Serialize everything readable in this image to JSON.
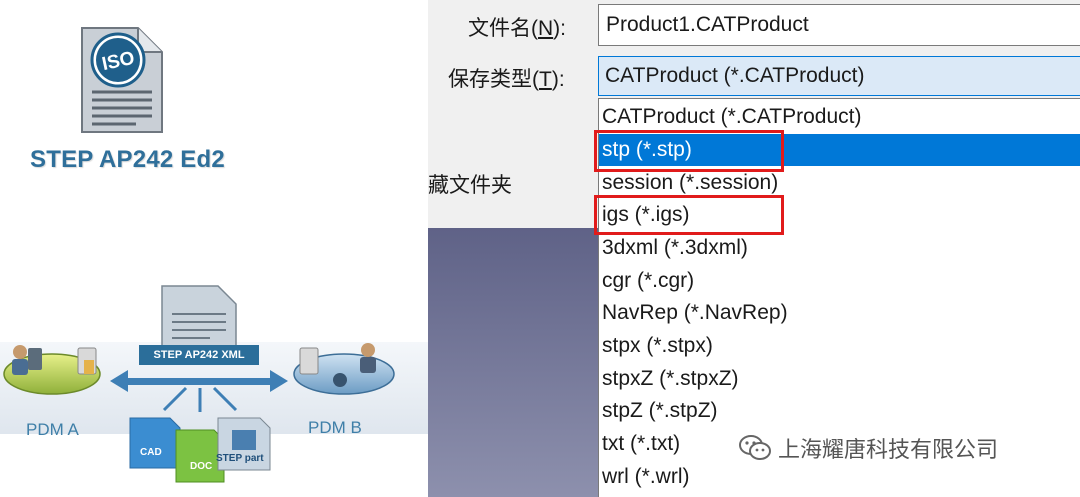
{
  "left_graphic": {
    "iso_badge": "ISO",
    "step_title": "STEP AP242 Ed2",
    "xml_label": "STEP AP242 XML",
    "pdm_a": "PDM A",
    "pdm_b": "PDM B",
    "file_cad": "CAD",
    "file_doc": "DOC",
    "file_step_part": "STEP part"
  },
  "dialog": {
    "filename_label_prefix": "文件名(",
    "filename_label_key": "N",
    "filename_label_suffix": "):",
    "filename_value": "Product1.CATProduct",
    "filetype_label_prefix": "保存类型(",
    "filetype_label_key": "T",
    "filetype_label_suffix": "):",
    "filetype_selected": "CATProduct (*.CATProduct)",
    "hidden_folders_label": "藏文件夹",
    "dropdown_options": [
      "CATProduct (*.CATProduct)",
      "stp (*.stp)",
      "session (*.session)",
      "igs (*.igs)",
      "3dxml (*.3dxml)",
      "cgr (*.cgr)",
      "NavRep (*.NavRep)",
      "stpx (*.stpx)",
      "stpxZ (*.stpxZ)",
      "stpZ (*.stpZ)",
      "txt (*.txt)",
      "wrl (*.wrl)"
    ],
    "highlighted_index": 1,
    "accent_color": "#0078d7",
    "annotation_color": "#e11b1b"
  },
  "watermark": {
    "icon": "wechat-icon",
    "text": "上海耀唐科技有限公司"
  }
}
